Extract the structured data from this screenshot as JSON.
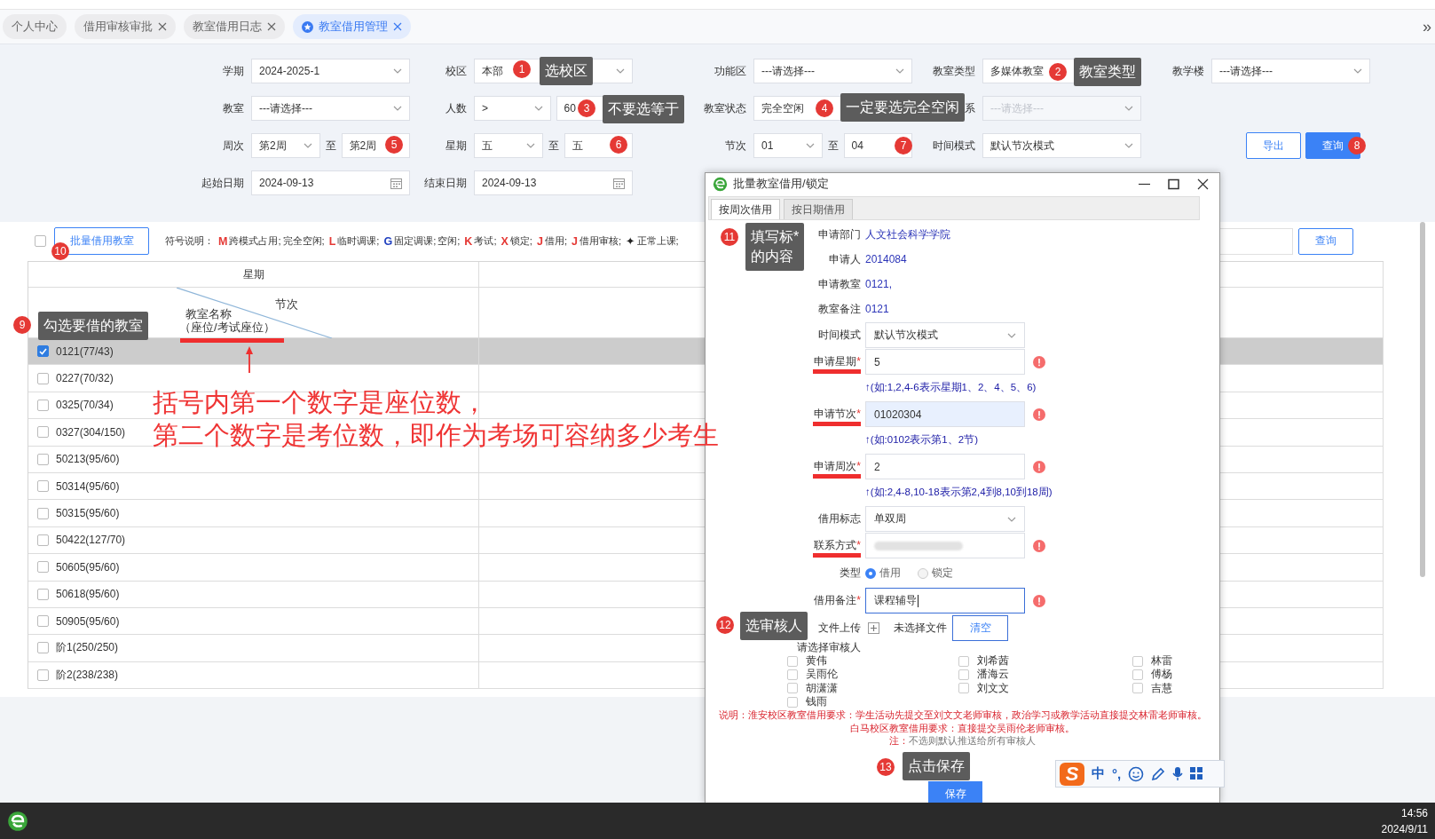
{
  "tabs": [
    {
      "label": "个人中心",
      "closable": false,
      "selected": false
    },
    {
      "label": "借用审核审批",
      "closable": true,
      "selected": false
    },
    {
      "label": "教室借用日志",
      "closable": true,
      "selected": false
    },
    {
      "label": "教室借用管理",
      "closable": true,
      "selected": true
    }
  ],
  "tabs_more": "»",
  "filters": [
    [
      {
        "label": "学期",
        "controls": [
          {
            "kind": "select",
            "value": "2024-2025-1"
          }
        ]
      },
      {
        "label": "校区",
        "controls": [
          {
            "kind": "select",
            "value": "本部"
          }
        ]
      },
      {
        "label": "功能区",
        "controls": [
          {
            "kind": "select",
            "value": "---请选择---"
          }
        ]
      },
      {
        "label": "教室类型",
        "controls": [
          {
            "kind": "select",
            "value": "多媒体教室"
          }
        ]
      },
      {
        "label": "教学楼",
        "controls": [
          {
            "kind": "select",
            "value": "---请选择---"
          }
        ]
      }
    ],
    [
      {
        "label": "教室",
        "controls": [
          {
            "kind": "select",
            "value": "---请选择---"
          }
        ]
      },
      {
        "label": "人数",
        "controls": [
          {
            "kind": "select",
            "value": ">"
          },
          {
            "kind": "input",
            "value": "60"
          }
        ]
      },
      {
        "label": "教室状态",
        "controls": [
          {
            "kind": "select",
            "value": "完全空闲"
          }
        ]
      },
      {
        "label": "系",
        "controls": [
          {
            "kind": "select",
            "placeholder": "---请选择---",
            "disabled": true
          }
        ]
      }
    ],
    [
      {
        "label": "周次",
        "controls": [
          {
            "kind": "select",
            "value": "第2周"
          },
          {
            "kind": "sep",
            "value": "至"
          },
          {
            "kind": "input",
            "value": "第2周"
          }
        ]
      },
      {
        "label": "星期",
        "controls": [
          {
            "kind": "select",
            "value": "五"
          },
          {
            "kind": "sep",
            "value": "至"
          },
          {
            "kind": "input",
            "value": "五"
          }
        ]
      },
      {
        "label": "节次",
        "controls": [
          {
            "kind": "select",
            "value": "01"
          },
          {
            "kind": "sep",
            "value": "至"
          },
          {
            "kind": "input",
            "value": "04"
          }
        ]
      },
      {
        "label": "时间模式",
        "controls": [
          {
            "kind": "select",
            "value": "默认节次模式"
          }
        ]
      },
      {
        "controls": [
          {
            "kind": "button",
            "value": "导出"
          },
          {
            "kind": "button-primary",
            "value": "查询"
          }
        ]
      }
    ],
    [
      {
        "label": "起始日期",
        "controls": [
          {
            "kind": "date",
            "value": "2024-09-13"
          }
        ]
      },
      {
        "label": "结束日期",
        "controls": [
          {
            "kind": "date",
            "value": "2024-09-13"
          }
        ]
      }
    ]
  ],
  "toolbar": {
    "select_all_checked": false,
    "batch_button": "批量借用教室",
    "legend_label": "符号说明：",
    "legend": [
      {
        "symbol": "M",
        "color": "#e53935",
        "text": "跨模式占用;"
      },
      {
        "text": "完全空闲;"
      },
      {
        "symbol": "L",
        "color": "#e53935",
        "text": "临时调课;"
      },
      {
        "symbol": "G",
        "color": "#1f3fbf",
        "text": "固定调课;"
      },
      {
        "text": "空闲;"
      },
      {
        "symbol": "K",
        "color": "#e53935",
        "text": "考试;"
      },
      {
        "symbol": "X",
        "color": "#e53935",
        "text": "锁定;"
      },
      {
        "symbol": "J",
        "color": "#e53935",
        "text": "借用;"
      },
      {
        "symbol": "J",
        "color": "#e53935",
        "text": "借用审核;"
      },
      {
        "symbol": "✦",
        "color": "#222222",
        "text": "正常上课;"
      }
    ],
    "search_button": "查询"
  },
  "table": {
    "columns": [
      "星期"
    ],
    "corner_top": "节次",
    "corner_bottom": [
      "教室名称",
      "（座位/考试座位）"
    ],
    "rows": [
      {
        "name": "0121(77/43)",
        "checked": true,
        "selected": true
      },
      {
        "name": "0227(70/32)",
        "checked": false,
        "selected": false
      },
      {
        "name": "0325(70/34)",
        "checked": false,
        "selected": false
      },
      {
        "name": "0327(304/150)",
        "checked": false,
        "selected": false
      },
      {
        "name": "50213(95/60)",
        "checked": false,
        "selected": false
      },
      {
        "name": "50314(95/60)",
        "checked": false,
        "selected": false
      },
      {
        "name": "50315(95/60)",
        "checked": false,
        "selected": false
      },
      {
        "name": "50422(127/70)",
        "checked": false,
        "selected": false
      },
      {
        "name": "50605(95/60)",
        "checked": false,
        "selected": false
      },
      {
        "name": "50618(95/60)",
        "checked": false,
        "selected": false
      },
      {
        "name": "50905(95/60)",
        "checked": false,
        "selected": false
      },
      {
        "name": "阶1(250/250)",
        "checked": false,
        "selected": false
      },
      {
        "name": "阶2(238/238)",
        "checked": false,
        "selected": false
      }
    ]
  },
  "annotations": [
    {
      "number": "1",
      "lines": [
        "选校区"
      ]
    },
    {
      "number": "2",
      "lines": [
        "教室类型"
      ]
    },
    {
      "number": "3",
      "lines": [
        "不要选等于"
      ]
    },
    {
      "number": "4",
      "lines": [
        "一定要选完全空闲"
      ]
    },
    {
      "number": "5"
    },
    {
      "number": "6"
    },
    {
      "number": "7"
    },
    {
      "number": "8"
    },
    {
      "number": "9",
      "lines": [
        "勾选要借的教室"
      ]
    },
    {
      "number": "10"
    },
    {
      "number": "11",
      "lines": [
        "填写标*",
        "的内容"
      ]
    },
    {
      "number": "12",
      "lines": [
        "选审核人"
      ]
    },
    {
      "number": "13",
      "lines": [
        "点击保存"
      ]
    }
  ],
  "callout": {
    "lines": [
      "括号内第一个数字是座位数，",
      "第二个数字是考位数，即作为考场可容纳多少考生"
    ]
  },
  "dialog": {
    "title": "批量教室借用/锁定",
    "tabs": [
      {
        "label": "按周次借用",
        "selected": true
      },
      {
        "label": "按日期借用",
        "selected": false
      }
    ],
    "info": [
      {
        "label": "申请部门",
        "value": "人文社会科学学院"
      },
      {
        "label": "申请人",
        "value": "2014084"
      },
      {
        "label": "申请教室",
        "value": "0121,"
      },
      {
        "label": "教室备注",
        "value": "0121"
      }
    ],
    "fields": [
      {
        "kind": "select",
        "label": "时间模式",
        "value": "默认节次模式"
      },
      {
        "kind": "input",
        "label": "申请星期",
        "required_mark": "*",
        "value": "5",
        "error": true,
        "underlined": true,
        "hint": "↑(如:1,2,4-6表示星期1、2、4、5、6)"
      },
      {
        "kind": "input",
        "label": "申请节次",
        "required_mark": "*",
        "value": "01020304",
        "highlighted": true,
        "error": true,
        "underlined": true,
        "hint": "↑(如:0102表示第1、2节)"
      },
      {
        "kind": "input",
        "label": "申请周次",
        "required_mark": "*",
        "value": "2",
        "error": true,
        "underlined": true,
        "hint": "↑(如:2,4-8,10-18表示第2,4到8,10到18周)"
      },
      {
        "kind": "select",
        "label": "借用标志",
        "value": "单双周"
      },
      {
        "kind": "input",
        "label": "联系方式",
        "required_mark": "*",
        "redacted": true,
        "error": true,
        "underlined": true
      },
      {
        "kind": "radio",
        "label": "类型",
        "options": [
          {
            "label": "借用",
            "selected": true
          },
          {
            "label": "锁定",
            "selected": false
          }
        ]
      },
      {
        "kind": "input",
        "label": "借用备注",
        "required_mark": "*",
        "value": "课程辅导",
        "focused": true,
        "error": true
      },
      {
        "kind": "upload",
        "label": "文件上传",
        "status": "未选择文件",
        "button": "清空"
      }
    ],
    "reviewers_label": "请选择审核人",
    "reviewers": [
      {
        "name": "黄伟",
        "checked": false
      },
      {
        "name": "刘希茜",
        "checked": false
      },
      {
        "name": "林雷",
        "checked": false
      },
      {
        "name": "吴雨伦",
        "checked": false
      },
      {
        "name": "潘海云",
        "checked": false
      },
      {
        "name": "傅杨",
        "checked": false
      },
      {
        "name": "胡潇潇",
        "checked": false
      },
      {
        "name": "刘文文",
        "checked": false
      },
      {
        "name": "吉慧",
        "checked": false
      },
      {
        "name": "钱雨",
        "checked": false
      }
    ],
    "note": "说明：淮安校区教室借用要求：学生活动先提交至刘文文老师审核，政治学习或教学活动直接提交林雷老师审核。白马校区教室借用要求：直接提交吴雨伦老师审核。",
    "note2_prefix": "注：",
    "note2": "不选则默认推送给所有审核人",
    "save": "保存"
  },
  "ime": {
    "logo": "S",
    "mode": "中",
    "punctuation": "°,"
  },
  "taskbar": {
    "time": "14:56",
    "date": "2024/9/11"
  }
}
